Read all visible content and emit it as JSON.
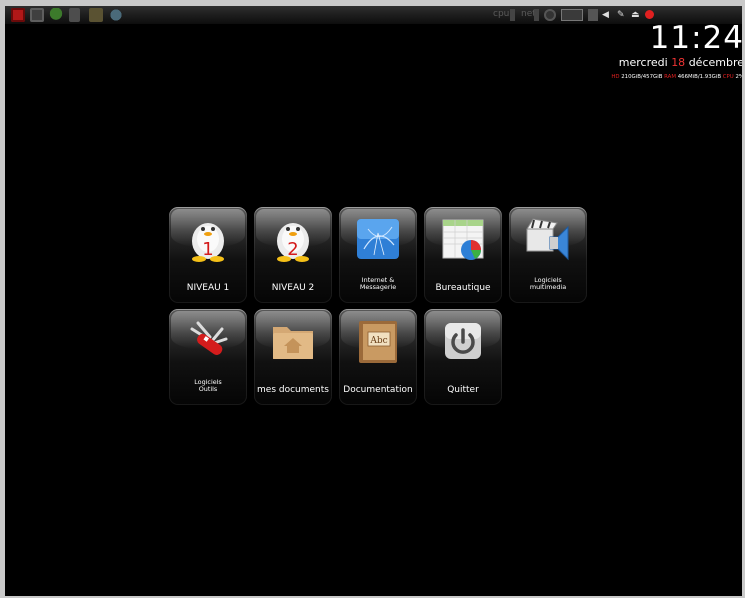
{
  "taskbar": {
    "left_icons": [
      "red-menu-icon",
      "window-icon",
      "tree-icon",
      "document-icon",
      "folder-icon",
      "globe-icon"
    ],
    "labels": [
      "cpu",
      "net"
    ]
  },
  "clock": {
    "time": "11:24",
    "weekday": "mercredi",
    "day": "18",
    "month": "décembre"
  },
  "system": {
    "hd_key": "HD",
    "hd_value": "210GiB/457GiB",
    "ram_key": "RAM",
    "ram_value": "466MiB/1.93GiB",
    "cpu_key": "CPU",
    "cpu_value": "2%"
  },
  "launcher": {
    "tiles": [
      {
        "label": "NIVEAU 1",
        "icon": "penguin-1-icon"
      },
      {
        "label": "NIVEAU 2",
        "icon": "penguin-2-icon"
      },
      {
        "label_line1": "Internet &",
        "label_line2": "Messagerie",
        "icon": "internet-globe-icon"
      },
      {
        "label": "Bureautique",
        "icon": "spreadsheet-chart-icon"
      },
      {
        "label_line1": "Logiciels",
        "label_line2": "multimedia",
        "icon": "clapper-speaker-icon"
      },
      {
        "label_line1": "Logiciels",
        "label_line2": "Outils",
        "icon": "swiss-knife-icon"
      },
      {
        "label": "mes documents",
        "icon": "home-folder-icon"
      },
      {
        "label": "Documentation",
        "icon": "abc-book-icon",
        "book_text": "Abc"
      },
      {
        "label": "Quitter",
        "icon": "power-icon"
      }
    ]
  },
  "colors": {
    "accent_red": "#e33333",
    "desktop": "#000000"
  }
}
